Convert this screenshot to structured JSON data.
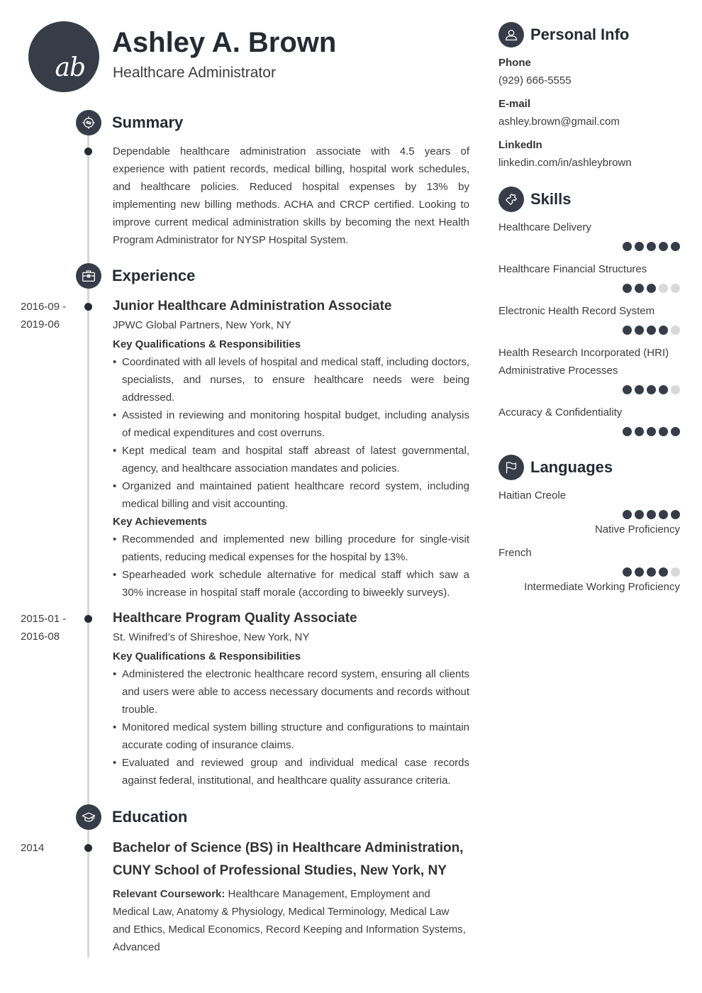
{
  "header": {
    "initials": "ab",
    "name": "Ashley A. Brown",
    "title": "Healthcare Administrator"
  },
  "summary": {
    "heading": "Summary",
    "icon": "target-icon",
    "text": "Dependable healthcare administration associate with 4.5 years of experience with patient records, medical billing, hospital work schedules, and healthcare policies. Reduced hospital expenses by 13% by implementing new billing methods. ACHA and CRCP certified. Looking to improve current medical administration skills by becoming the next Health Program Administrator for NYSP Hospital System."
  },
  "experience": {
    "heading": "Experience",
    "icon": "briefcase-icon",
    "jobs": [
      {
        "date_start": "2016-09 -",
        "date_end": "2019-06",
        "title": "Junior Healthcare Administration Associate",
        "company": "JPWC Global Partners, New York, NY",
        "resp_heading": "Key Qualifications & Responsibilities",
        "responsibilities": [
          "Coordinated with all levels of hospital and medical staff, including doctors, specialists, and nurses, to ensure healthcare needs were being addressed.",
          "Assisted in reviewing and monitoring hospital budget, including analysis of medical expenditures and cost overruns.",
          "Kept medical team and hospital staff abreast of latest governmental, agency, and healthcare association mandates and policies.",
          "Organized and maintained patient healthcare record system, including medical billing and visit accounting."
        ],
        "ach_heading": "Key Achievements",
        "achievements": [
          "Recommended and implemented new billing procedure for single-visit patients, reducing medical expenses for the hospital by 13%.",
          "Spearheaded work schedule alternative for medical staff which saw a 30% increase in hospital staff morale (according to biweekly surveys)."
        ]
      },
      {
        "date_start": "2015-01 -",
        "date_end": "2016-08",
        "title": "Healthcare Program Quality Associate",
        "company": "St. Winifred’s of Shireshoe, New York, NY",
        "resp_heading": "Key Qualifications & Responsibilities",
        "responsibilities": [
          "Administered the electronic healthcare record system, ensuring all clients and users were able to access necessary documents and records without trouble.",
          "Monitored medical system billing structure and configurations to maintain accurate coding of insurance claims.",
          "Evaluated and reviewed group and individual medical case records against federal, institutional, and healthcare quality assurance criteria."
        ]
      }
    ]
  },
  "education": {
    "heading": "Education",
    "icon": "graduation-cap-icon",
    "items": [
      {
        "date": "2014",
        "title": "Bachelor of Science (BS) in Healthcare Administration, CUNY School of Professional Studies, New York, NY",
        "coursework_label": "Relevant Coursework:",
        "coursework": " Healthcare Management, Employment and Medical Law, Anatomy & Physiology, Medical Terminology, Medical Law and Ethics, Medical Economics, Record Keeping and Information Systems, Advanced"
      }
    ]
  },
  "personal_info": {
    "heading": "Personal Info",
    "icon": "user-icon",
    "fields": [
      {
        "label": "Phone",
        "value": "(929) 666-5555"
      },
      {
        "label": "E-mail",
        "value": "ashley.brown@gmail.com"
      },
      {
        "label": "LinkedIn",
        "value": "linkedin.com/in/ashleybrown"
      }
    ]
  },
  "skills": {
    "heading": "Skills",
    "icon": "puzzle-icon",
    "max_rating": 5,
    "items": [
      {
        "name": "Healthcare Delivery",
        "rating": 5
      },
      {
        "name": "Healthcare Financial Structures",
        "rating": 3
      },
      {
        "name": "Electronic Health Record System",
        "rating": 4
      },
      {
        "name": "Health Research Incorporated (HRI) Administrative Processes",
        "rating": 4
      },
      {
        "name": "Accuracy & Confidentiality",
        "rating": 5
      }
    ]
  },
  "languages": {
    "heading": "Languages",
    "icon": "flag-icon",
    "max_rating": 5,
    "items": [
      {
        "name": "Haitian Creole",
        "rating": 5,
        "level": "Native Proficiency"
      },
      {
        "name": "French",
        "rating": 4,
        "level": "Intermediate Working Proficiency"
      }
    ]
  },
  "colors": {
    "accent": "#373d48",
    "heading": "#252a33",
    "body_text": "#3c3c3c",
    "timeline": "#d6d6d6",
    "rating_off": "#d9d9d9"
  }
}
